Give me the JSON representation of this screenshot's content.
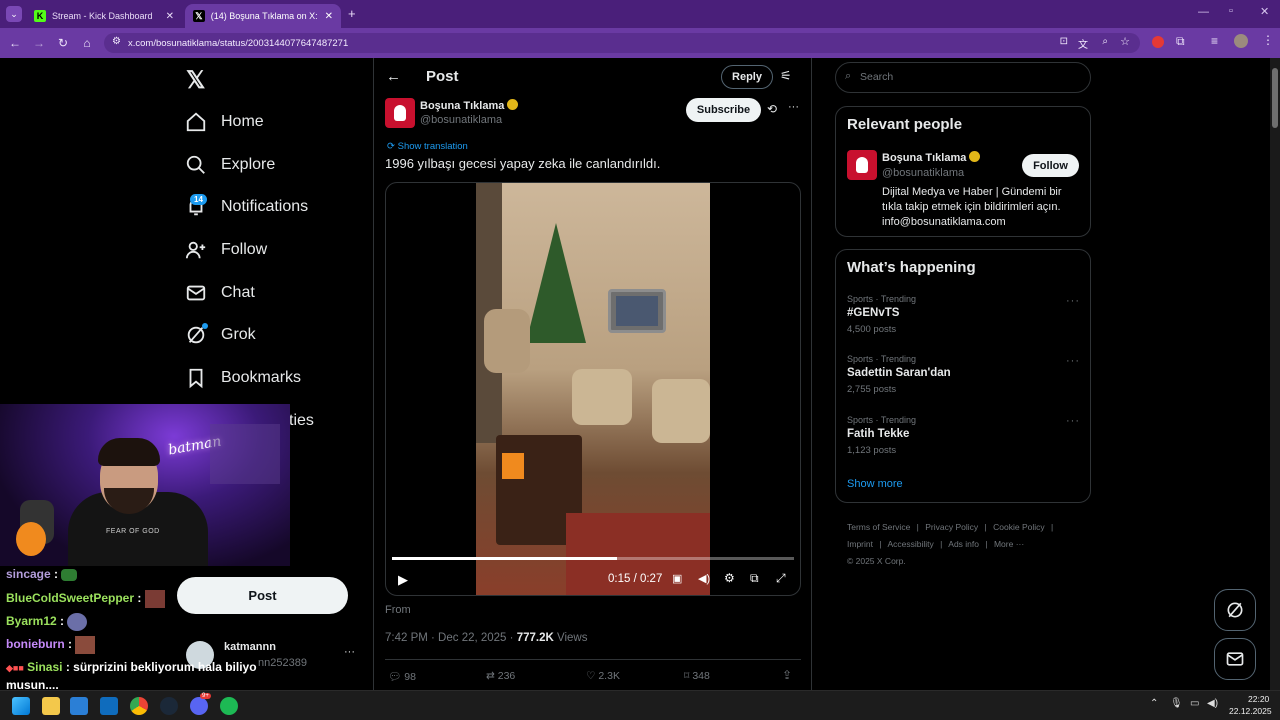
{
  "browser": {
    "tabs": [
      {
        "title": "Stream - Kick Dashboard",
        "active": false
      },
      {
        "title": "(14) Boşuna Tıklama on X: \"199…",
        "active": true
      }
    ],
    "url": "x.com/bosunatiklama/status/2003144077647487271"
  },
  "leftnav": {
    "items": [
      {
        "label": "Home",
        "icon": "home-icon"
      },
      {
        "label": "Explore",
        "icon": "search-icon"
      },
      {
        "label": "Notifications",
        "icon": "bell-icon",
        "badge": "14"
      },
      {
        "label": "Follow",
        "icon": "person-add-icon"
      },
      {
        "label": "Chat",
        "icon": "mail-icon"
      },
      {
        "label": "Grok",
        "icon": "grok-icon"
      },
      {
        "label": "Bookmarks",
        "icon": "bookmark-icon"
      },
      {
        "label": "ties",
        "icon": ""
      }
    ],
    "post_button": "Post",
    "account": {
      "name": "katmannn",
      "handle": "nn252389"
    }
  },
  "post": {
    "header_title": "Post",
    "reply_label": "Reply",
    "author_name": "Boşuna Tıklama",
    "author_handle": "@bosunatiklama",
    "subscribe_label": "Subscribe",
    "show_translation": "Show translation",
    "text": "1996 yılbaşı gecesi yapay zeka ile canlandırıldı.",
    "video": {
      "time": "0:15 / 0:27",
      "progress": 0.56
    },
    "from_label": "From",
    "timestamp": "7:42 PM · Dec 22, 2025 ·",
    "views_count": "777.2K",
    "views_label": "Views",
    "stats": {
      "replies": "98",
      "reposts": "236",
      "likes": "2.3K",
      "bookmarks": "348"
    }
  },
  "right": {
    "search_placeholder": "Search",
    "relevant_title": "Relevant people",
    "person": {
      "name": "Boşuna Tıklama",
      "handle": "@bosunatiklama",
      "follow": "Follow",
      "bio": "Dijital Medya ve Haber | Gündemi bir tıkla takip etmek için bildirimleri açın. info@bosunatiklama.com"
    },
    "happening_title": "What’s happening",
    "trends": [
      {
        "category": "Sports · Trending",
        "name": "#GENvTS",
        "count": "4,500 posts"
      },
      {
        "category": "Sports · Trending",
        "name": "Sadettin Saran'dan",
        "count": "2,755 posts"
      },
      {
        "category": "Sports · Trending",
        "name": "Fatih Tekke",
        "count": "1,123 posts"
      }
    ],
    "show_more": "Show more",
    "footer": [
      "Terms of Service",
      "Privacy Policy",
      "Cookie Policy",
      "Imprint",
      "Accessibility",
      "Ads info",
      "More ···",
      "© 2025 X Corp."
    ]
  },
  "stream_chat": [
    {
      "user": "sincage",
      "msg": ":",
      "color": "#b39ddb"
    },
    {
      "user": "BlueColdSweetPepper",
      "msg": ":",
      "color": "#9be15d"
    },
    {
      "user": "Byarm12",
      "msg": ":",
      "color": "#9be15d"
    },
    {
      "user": "bonieburn",
      "msg": ":",
      "color": "#c58af9"
    },
    {
      "user": "Sinasi",
      "msg": ": sürprizini bekliyorum hala biliyo musun....",
      "color": "#9be15d"
    }
  ],
  "webcam": {
    "shirt_text": "FEAR OF GOD",
    "neon_text": "batman"
  },
  "taskbar": {
    "time": "22:20",
    "date": "22.12.2025",
    "discord_badge": "9+"
  },
  "colors": {
    "x_blue": "#1d9bf0",
    "browser_purple": "#6a3aa3",
    "verified_gold": "#e2b719"
  }
}
